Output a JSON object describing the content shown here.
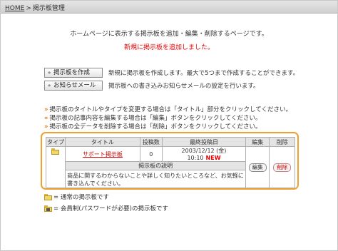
{
  "header": {
    "home_link": "HOME",
    "separator": ">",
    "page": "掲示板管理"
  },
  "intro_text": "ホームページに表示する掲示板を追加・編集・削除するページです。",
  "status_message": "新規に掲示板を追加しました。",
  "actions": [
    {
      "label": "掲示板を作成",
      "description": "新規に掲示板を作成します。最大で5つまで作成することができます。"
    },
    {
      "label": "お知らせメール",
      "description": "掲示板への書き込みお知らせメールの設定を行います。"
    }
  ],
  "notes": [
    "掲示板のタイトルやタイプを変更する場合は「タイトル」部分をクリックしてください。",
    "掲示板の記事内容を編集する場合は「編集」ボタンをクリックしてください。",
    "掲示板の全データを削除する場合は「削除」ボタンをクリックしてください。"
  ],
  "table": {
    "headers": {
      "type": "タイプ",
      "title": "タイトル",
      "posts": "投稿数",
      "last_post": "最終投稿日",
      "edit": "編集",
      "delete": "削除"
    },
    "rows": [
      {
        "type_icon": "folder-icon",
        "title": "サポート掲示板",
        "posts": "0",
        "last_post": "2003/12/12 (金) 10:10",
        "new_badge": "NEW",
        "edit_label": "編集",
        "delete_label": "削除",
        "description_header": "掲示板の説明",
        "description": "商品に関するわからないことや詳しく知りたいところなど、お気軽に書き込んでください。"
      }
    ]
  },
  "legend": [
    {
      "icon": "folder-icon",
      "text": "= 通常の掲示板です"
    },
    {
      "icon": "locked-folder-icon",
      "text": "= 会員制(パスワードが必要)の掲示板です"
    }
  ],
  "colors": {
    "accent_orange": "#f0a030",
    "alert_red": "#e60000"
  }
}
